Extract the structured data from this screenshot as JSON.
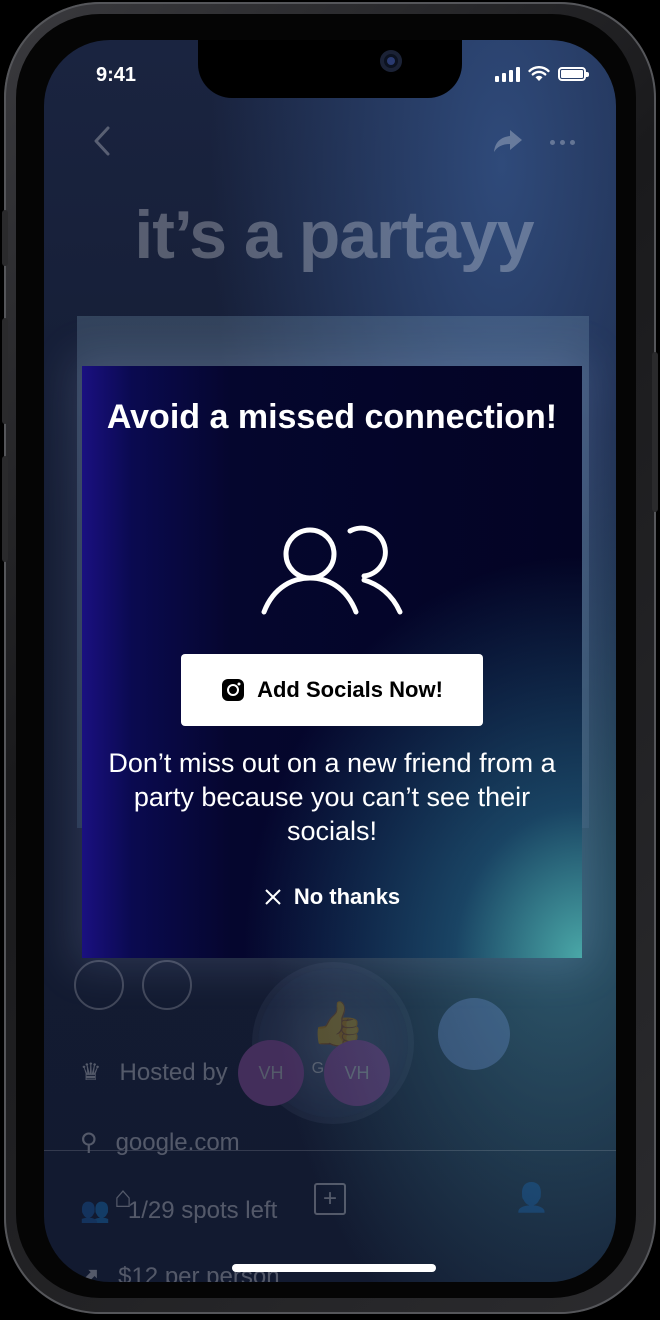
{
  "status_bar": {
    "time": "9:41"
  },
  "event": {
    "title": "it’s a partayy",
    "going_label": "Going",
    "attendees": [
      "VH",
      "VH"
    ],
    "hosted_by_label": "Hosted by",
    "location": "google.com",
    "spots": "1/29 spots left",
    "price": "$12 per person"
  },
  "modal": {
    "title": "Avoid a missed connection!",
    "primary_button": "Add Socials Now!",
    "description": "Don’t miss out on a new friend from a party because you can’t see their socials!",
    "dismiss": "No thanks"
  },
  "icons": {
    "people": "people-icon",
    "instagram": "instagram-icon",
    "close": "close-icon"
  }
}
